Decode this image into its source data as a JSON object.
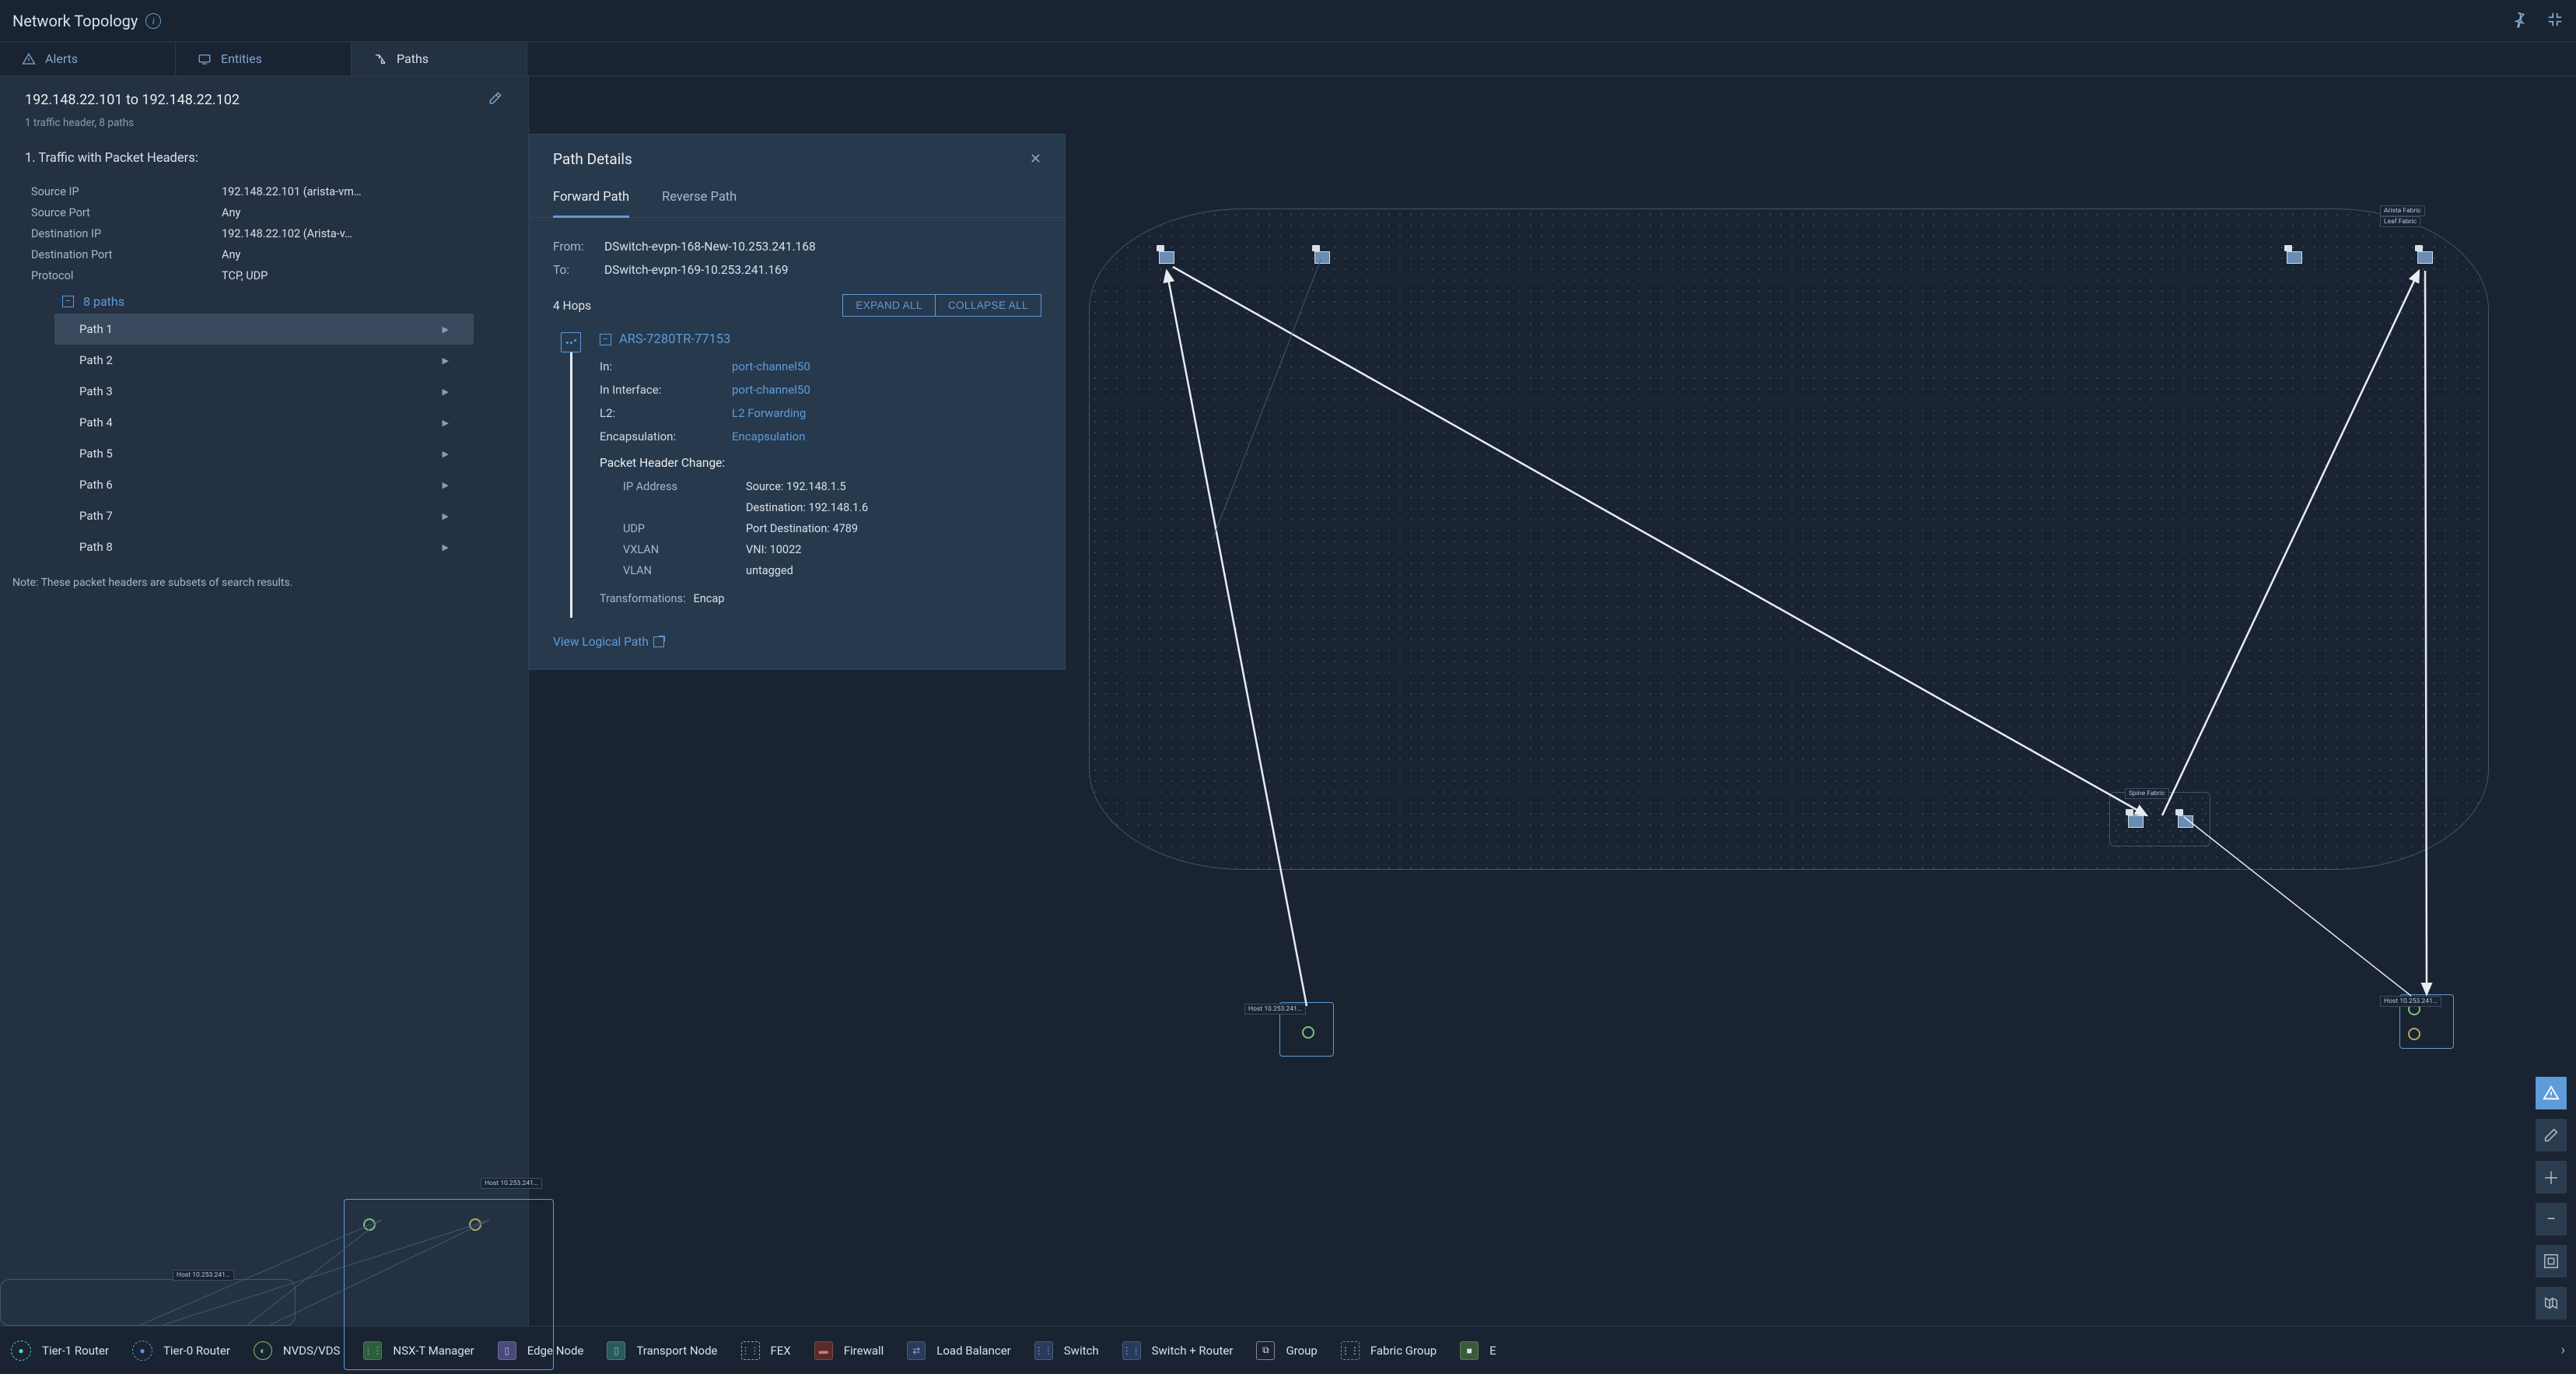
{
  "header": {
    "title": "Network Topology"
  },
  "subnav": {
    "alerts": "Alerts",
    "entities": "Entities",
    "paths": "Paths"
  },
  "leftPanel": {
    "title": "192.148.22.101 to 192.148.22.102",
    "subtitle": "1 traffic header, 8 paths",
    "trafficHeading": "1. Traffic with Packet Headers:",
    "kv": {
      "srcIpLabel": "Source IP",
      "srcIp": "192.148.22.101 (arista-vm…",
      "srcPortLabel": "Source Port",
      "srcPort": "Any",
      "dstIpLabel": "Destination IP",
      "dstIp": "192.148.22.102 (Arista-v…",
      "dstPortLabel": "Destination Port",
      "dstPort": "Any",
      "protoLabel": "Protocol",
      "proto": "TCP, UDP"
    },
    "pathsHead": "8 paths",
    "paths": [
      "Path 1",
      "Path 2",
      "Path 3",
      "Path 4",
      "Path 5",
      "Path 6",
      "Path 7",
      "Path 8"
    ],
    "note": "Note: These packet headers are subsets of search results."
  },
  "details": {
    "title": "Path Details",
    "tabs": {
      "fwd": "Forward Path",
      "rev": "Reverse Path"
    },
    "fromLabel": "From:",
    "fromVal": "DSwitch-evpn-168-New-10.253.241.168",
    "toLabel": "To:",
    "toVal": "DSwitch-evpn-169-10.253.241.169",
    "hops": "4 Hops",
    "expand": "EXPAND ALL",
    "collapse": "COLLAPSE ALL",
    "hop1": {
      "name": "ARS-7280TR-77153",
      "inLbl": "In:",
      "inVal": "port-channel50",
      "inIfLbl": "In Interface:",
      "inIfVal": "port-channel50",
      "l2Lbl": "L2:",
      "l2Val": "L2 Forwarding",
      "encLbl": "Encapsulation:",
      "encVal": "Encapsulation",
      "pktHead": "Packet Header Change:",
      "ipLbl": "IP Address",
      "ipSrc": "Source: 192.148.1.5",
      "ipDst": "Destination: 192.148.1.6",
      "udpLbl": "UDP",
      "udpVal": "Port Destination: 4789",
      "vxLbl": "VXLAN",
      "vxVal": "VNI: 10022",
      "vlanLbl": "VLAN",
      "vlanVal": "untagged",
      "transLbl": "Transformations:",
      "transVal": "Encap"
    },
    "viewLink": "View Logical Path"
  },
  "labels": {
    "aristaFabric": "Arista Fabric",
    "leafFabric": "Leaf Fabric",
    "spineFabric": "Spine Fabric",
    "host241": "Host 10.253.241…",
    "host241b": "Host 10.253.241…"
  },
  "legend": {
    "t1": "Tier-1 Router",
    "t0": "Tier-0 Router",
    "nv": "NVDS/VDS",
    "nsx": "NSX-T Manager",
    "edge": "Edge Node",
    "tn": "Transport Node",
    "fex": "FEX",
    "fw": "Firewall",
    "lb": "Load Balancer",
    "sw": "Switch",
    "swr": "Switch + Router",
    "grp": "Group",
    "fg": "Fabric Group",
    "more": "E"
  }
}
